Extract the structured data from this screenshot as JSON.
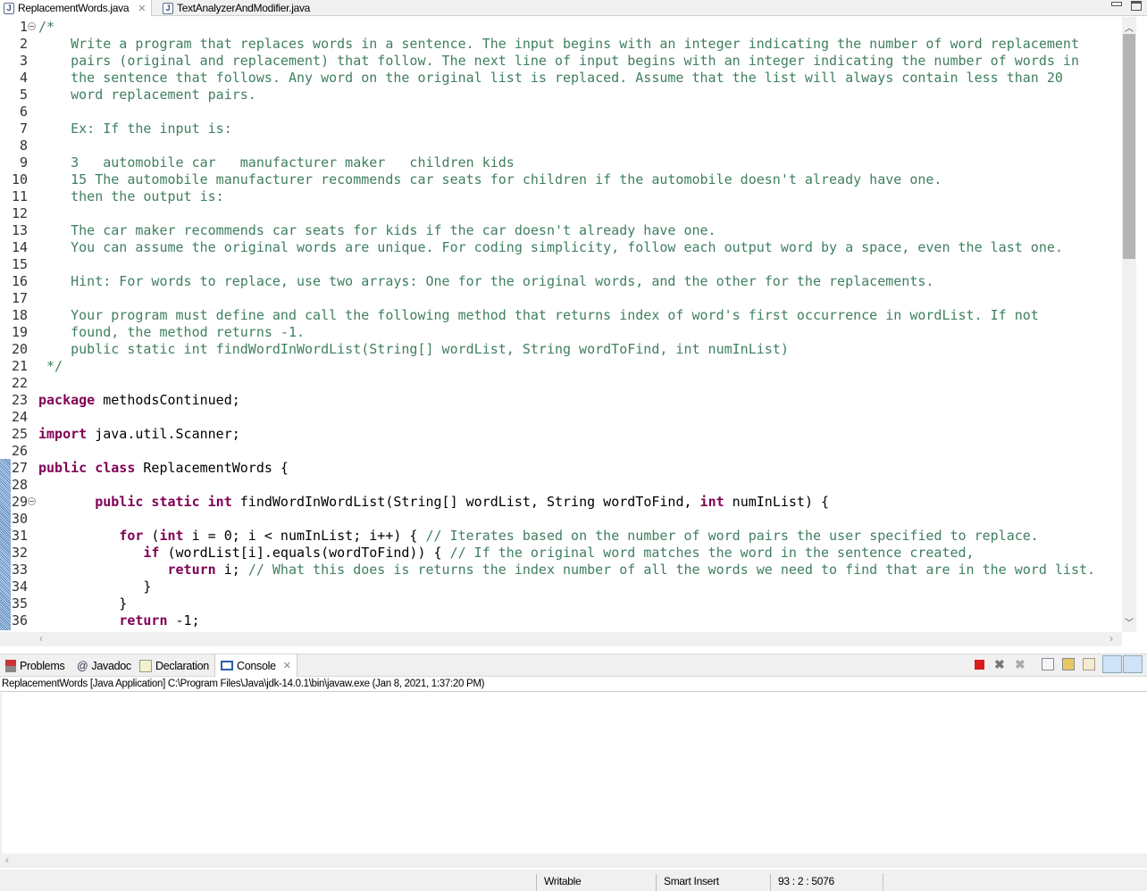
{
  "editor_tabs": [
    {
      "label": "ReplacementWords.java",
      "active": true
    },
    {
      "label": "TextAnalyzerAndModifier.java",
      "active": false
    }
  ],
  "tab_icon": "J",
  "code_lines": [
    [
      [
        "c",
        "/*"
      ]
    ],
    [
      [
        "c",
        "    Write a program that replaces words in a sentence. The input begins with an integer indicating the number of word replacement"
      ]
    ],
    [
      [
        "c",
        "    pairs (original and replacement) that follow. The next line of input begins with an integer indicating the number of words in"
      ]
    ],
    [
      [
        "c",
        "    the sentence that follows. Any word on the original list is replaced. Assume that the list will always contain less than 20"
      ]
    ],
    [
      [
        "c",
        "    word replacement pairs."
      ]
    ],
    [],
    [
      [
        "c",
        "    Ex: If the input is:"
      ]
    ],
    [],
    [
      [
        "c",
        "    3   automobile car   manufacturer maker   children kids"
      ]
    ],
    [
      [
        "c",
        "    15 The automobile manufacturer recommends car seats for children if the automobile doesn't already have one."
      ]
    ],
    [
      [
        "c",
        "    then the output is:"
      ]
    ],
    [],
    [
      [
        "c",
        "    The car maker recommends car seats for kids if the car doesn't already have one."
      ]
    ],
    [
      [
        "c",
        "    You can assume the original words are unique. For coding simplicity, follow each output word by a space, even the last one."
      ]
    ],
    [],
    [
      [
        "c",
        "    Hint: For words to replace, use two arrays: One for the original words, and the other for the replacements."
      ]
    ],
    [],
    [
      [
        "c",
        "    Your program must define and call the following method that returns index of word's first occurrence in wordList. If not"
      ]
    ],
    [
      [
        "c",
        "    found, the method returns -1."
      ]
    ],
    [
      [
        "c",
        "    public static int findWordInWordList(String[] wordList, String wordToFind, int numInList)"
      ]
    ],
    [
      [
        "c",
        " */"
      ]
    ],
    [],
    [
      [
        "k",
        "package"
      ],
      [
        "t",
        " methodsContinued;"
      ]
    ],
    [],
    [
      [
        "k",
        "import"
      ],
      [
        "t",
        " java.util.Scanner;"
      ]
    ],
    [],
    [
      [
        "k",
        "public class"
      ],
      [
        "t",
        " ReplacementWords {"
      ]
    ],
    [],
    [
      [
        "t",
        "       "
      ],
      [
        "k",
        "public static int"
      ],
      [
        "t",
        " findWordInWordList(String[] wordList, String wordToFind, "
      ],
      [
        "k",
        "int"
      ],
      [
        "t",
        " numInList) {"
      ]
    ],
    [],
    [
      [
        "t",
        "          "
      ],
      [
        "k",
        "for"
      ],
      [
        "t",
        " ("
      ],
      [
        "k",
        "int"
      ],
      [
        "t",
        " i = 0; i < numInList; i++) { "
      ],
      [
        "c",
        "// Iterates based on the number of word pairs the user specified to replace."
      ]
    ],
    [
      [
        "t",
        "             "
      ],
      [
        "k",
        "if"
      ],
      [
        "t",
        " (wordList[i].equals(wordToFind)) { "
      ],
      [
        "c",
        "// If the original word matches the word in the sentence created,"
      ]
    ],
    [
      [
        "t",
        "                "
      ],
      [
        "k",
        "return"
      ],
      [
        "t",
        " i; "
      ],
      [
        "c",
        "// What this does is returns the index number of all the words we need to find that are in the word list."
      ]
    ],
    [
      [
        "t",
        "             }"
      ]
    ],
    [
      [
        "t",
        "          }"
      ]
    ],
    [
      [
        "t",
        "          "
      ],
      [
        "k",
        "return"
      ],
      [
        "t",
        " -1;"
      ]
    ]
  ],
  "fold_lines": [
    1,
    29
  ],
  "console_tabs": [
    {
      "label": "Problems",
      "icon": "problems-icon"
    },
    {
      "label": "Javadoc",
      "icon": "at-icon"
    },
    {
      "label": "Declaration",
      "icon": "declaration-icon"
    },
    {
      "label": "Console",
      "icon": "console-icon",
      "active": true
    }
  ],
  "console_info": "ReplacementWords [Java Application] C:\\Program Files\\Java\\jdk-14.0.1\\bin\\javaw.exe  (Jan 8, 2021, 1:37:20 PM)",
  "console_toolbar": [
    "terminate-icon",
    "remove-launch-icon",
    "remove-all-terminated-icon",
    "clear-console-icon",
    "scroll-lock-icon",
    "word-wrap-icon",
    "show-console-on-output-icon",
    "show-console-on-error-icon"
  ],
  "status": {
    "mode": "Writable",
    "insert": "Smart Insert",
    "position": "93 : 2 : 5076"
  },
  "colors": {
    "comment": "#3f7f5f",
    "keyword": "#7f0055"
  }
}
